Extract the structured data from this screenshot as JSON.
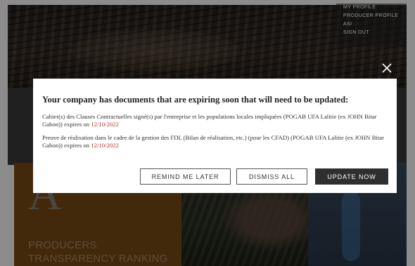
{
  "profile_menu": {
    "items": [
      "MY PROFILE",
      "PRODUCER PROFILE",
      "ASI",
      "SIGN OUT"
    ]
  },
  "background": {
    "ranking_letter": "A",
    "ranking_title_line1": "PRODUCERS",
    "ranking_title_line2": "TRANSPARENCY RANKING"
  },
  "modal": {
    "heading": "Your company has documents that are expiring soon that will need to be updated:",
    "documents": [
      {
        "text": "Cahier(s) des Clauses Contractuelles signé(s) par l'entreprise et les populations locales impliquées (POGAB UFA Lalitie (ex JOHN Bitar Gabon)) expires on ",
        "date": "12/10/2022"
      },
      {
        "text": "Preuve de réalisation dans le cadre de la gestion des FDL (Bilan de réalisation, etc.) (pour les CFAD) (POGAB UFA Lalitie (ex JOHN Bitar Gabon)) expires on ",
        "date": "12/10/2022"
      }
    ],
    "buttons": {
      "remind_later": "REMIND ME LATER",
      "dismiss_all": "DISMISS ALL",
      "update_now": "UPDATE NOW"
    }
  },
  "colors": {
    "expiry_date": "#c62828",
    "primary_button": "#2f2f2f",
    "ranking_panel": "#7a4b14"
  },
  "icons": {
    "close": "close-icon"
  }
}
